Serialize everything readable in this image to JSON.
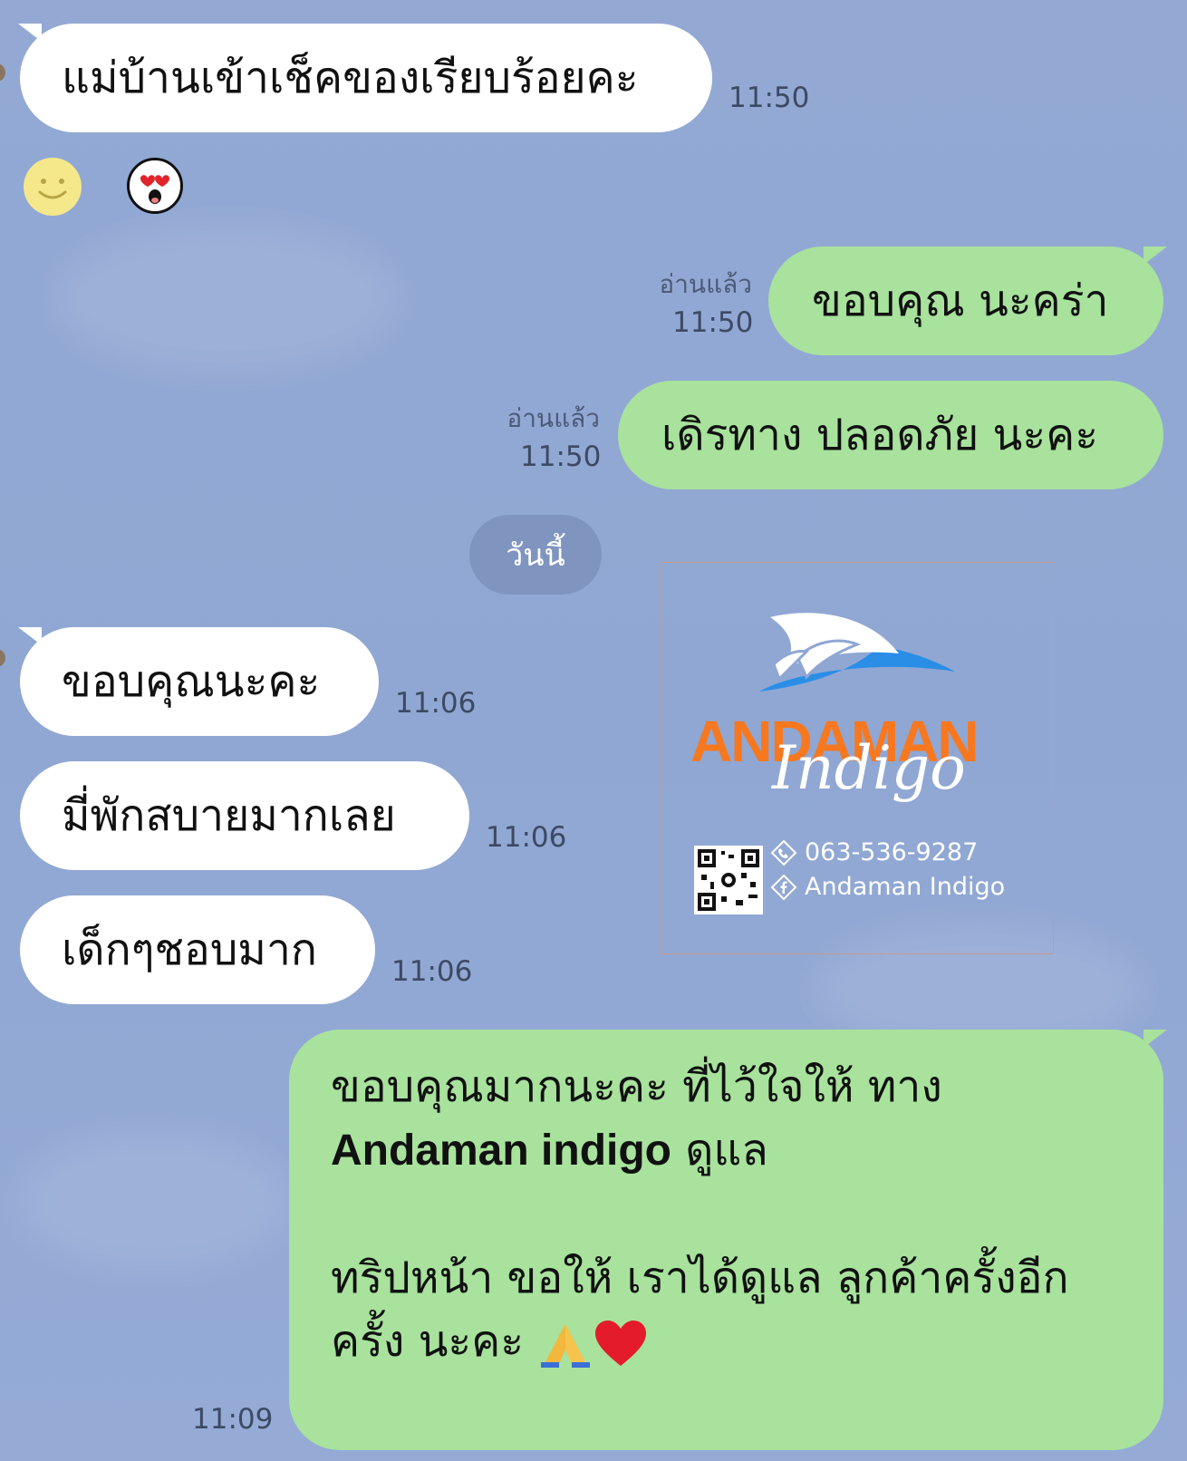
{
  "messages_top": {
    "in_1": {
      "text": "แม่บ้านเข้าเช็คของเรียบร้อยคะ",
      "time": "11:50"
    },
    "reactions": [
      {
        "icon": "smile-sticker-icon"
      },
      {
        "icon": "heart-eyes-sticker-icon"
      }
    ],
    "out_1": {
      "text": "ขอบคุณ นะคร่า",
      "read": "อ่านแล้ว",
      "time": "11:50"
    },
    "out_2": {
      "text": "เดิรทาง ปลอดภัย นะคะ",
      "read": "อ่านแล้ว",
      "time": "11:50"
    }
  },
  "day_separator": "วันนี้",
  "messages_today": {
    "in_1": {
      "text": "ขอบคุณนะคะ",
      "time": "11:06"
    },
    "in_2": {
      "text": "มี่พักสบายมากเลย",
      "time": "11:06"
    },
    "in_3": {
      "text": "เด็กๆชอบมาก",
      "time": "11:06"
    }
  },
  "brand_card": {
    "title": "ANDAMAN",
    "script": "Indigo",
    "phone": "063-536-9287",
    "facebook": "Andaman Indigo",
    "colors": {
      "orange": "#f7781f",
      "blue": "#1e8fe0"
    }
  },
  "reply": {
    "line1": "ขอบคุณมากนะคะ ที่ไว้ใจให้ ทาง",
    "brand": "Andaman indigo",
    "line2_rest": " ดูแล",
    "line3": "ทริปหน้า ขอให้ เราได้ดูแล ลูกค้าครั้งอีก",
    "line4": "ครั้ง นะคะ ",
    "time": "11:09"
  },
  "colors": {
    "incoming": "#ffffff",
    "outgoing": "#a8e29d",
    "background": "#93a9d4"
  }
}
